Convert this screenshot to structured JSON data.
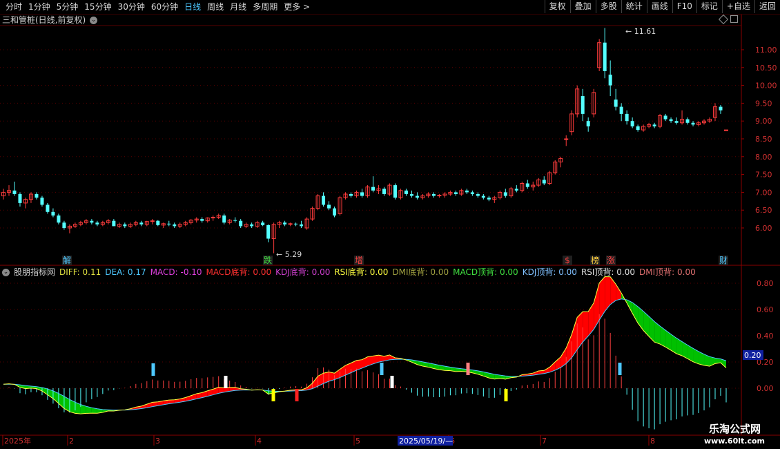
{
  "toolbar": {
    "periods": [
      "分时",
      "1分钟",
      "5分钟",
      "15分钟",
      "30分钟",
      "60分钟",
      "日线",
      "周线",
      "月线",
      "多周期",
      "更多 >"
    ],
    "active_period": "日线",
    "right_buttons": [
      "复权",
      "叠加",
      "多股",
      "统计",
      "画线",
      "F10",
      "标记",
      "+自选",
      "返回"
    ]
  },
  "chart_title": "三和管桩(日线,前复权)",
  "price_axis": [
    "11.00",
    "10.50",
    "10.00",
    "9.50",
    "9.00",
    "8.50",
    "8.00",
    "7.50",
    "7.00",
    "6.50",
    "6.00"
  ],
  "price_high_label": "11.61",
  "price_low_label": "5.29",
  "event_markers": [
    {
      "label": "解",
      "color": "#4ec8ff"
    },
    {
      "label": "跌",
      "color": "#40e040"
    },
    {
      "label": "增",
      "color": "#ff4040"
    },
    {
      "label": "$",
      "color": "#ff4040"
    },
    {
      "label": "榜",
      "color": "#ffd040"
    },
    {
      "label": "涨",
      "color": "#ff4040"
    },
    {
      "label": "财",
      "color": "#4ec8ff"
    }
  ],
  "indicator": {
    "name": "股朋指标网",
    "values": [
      {
        "label": "DIFF: 0.11",
        "color": "#e0e040"
      },
      {
        "label": "DEA: 0.17",
        "color": "#4ec8ff"
      },
      {
        "label": "MACD: -0.10",
        "color": "#e040e0"
      },
      {
        "label": "MACD底背: 0.00",
        "color": "#ff3030"
      },
      {
        "label": "KDJ底背: 0.00",
        "color": "#d040d0"
      },
      {
        "label": "RSI底背: 0.00",
        "color": "#ffff40"
      },
      {
        "label": "DMI底背: 0.00",
        "color": "#a0a040"
      },
      {
        "label": "MACD顶背: 0.00",
        "color": "#40e040"
      },
      {
        "label": "KDJ顶背: 0.00",
        "color": "#80c0ff"
      },
      {
        "label": "RSI顶背: 0.00",
        "color": "#e0e0e0"
      },
      {
        "label": "DMI顶背: 0.00",
        "color": "#e07070"
      }
    ]
  },
  "indicator_axis": [
    "0.80",
    "0.60",
    "0.40",
    "0.20",
    "0.00"
  ],
  "indicator_current": "0.20",
  "date_axis": [
    "2025年",
    "2",
    "3",
    "4",
    "5",
    "6",
    "7",
    "8"
  ],
  "crosshair_date": "2025/05/19/—",
  "watermark": {
    "line1": "乐淘公式网",
    "line2": "www.60lt.com"
  },
  "chart_data": {
    "type": "candlestick",
    "title": "三和管桩(日线,前复权)",
    "ylim": [
      5.2,
      11.8
    ],
    "candles": [
      [
        6.9,
        7.1,
        6.8,
        7.0
      ],
      [
        7.0,
        7.2,
        6.9,
        7.05
      ],
      [
        7.05,
        7.3,
        6.9,
        6.95
      ],
      [
        6.95,
        7.0,
        6.6,
        6.7
      ],
      [
        6.7,
        6.85,
        6.55,
        6.8
      ],
      [
        6.8,
        7.0,
        6.7,
        6.95
      ],
      [
        6.95,
        7.0,
        6.8,
        6.85
      ],
      [
        6.85,
        6.9,
        6.6,
        6.65
      ],
      [
        6.65,
        6.7,
        6.4,
        6.45
      ],
      [
        6.45,
        6.55,
        6.3,
        6.35
      ],
      [
        6.35,
        6.4,
        6.1,
        6.15
      ],
      [
        6.15,
        6.2,
        5.95,
        6.0
      ],
      [
        6.0,
        6.1,
        5.85,
        6.05
      ],
      [
        6.05,
        6.15,
        6.0,
        6.1
      ],
      [
        6.1,
        6.2,
        6.05,
        6.15
      ],
      [
        6.15,
        6.25,
        6.1,
        6.2
      ],
      [
        6.2,
        6.25,
        6.1,
        6.15
      ],
      [
        6.15,
        6.2,
        6.05,
        6.1
      ],
      [
        6.1,
        6.2,
        6.05,
        6.15
      ],
      [
        6.15,
        6.25,
        6.1,
        6.2
      ],
      [
        6.2,
        6.25,
        6.05,
        6.05
      ],
      [
        6.05,
        6.15,
        6.0,
        6.1
      ],
      [
        6.1,
        6.15,
        6.0,
        6.05
      ],
      [
        6.05,
        6.15,
        6.0,
        6.1
      ],
      [
        6.1,
        6.2,
        6.05,
        6.15
      ],
      [
        6.15,
        6.2,
        6.05,
        6.1
      ],
      [
        6.1,
        6.2,
        6.05,
        6.18
      ],
      [
        6.18,
        6.25,
        6.1,
        6.2
      ],
      [
        6.2,
        6.22,
        6.05,
        6.08
      ],
      [
        6.08,
        6.15,
        6.0,
        6.12
      ],
      [
        6.12,
        6.2,
        6.05,
        6.1
      ],
      [
        6.1,
        6.15,
        6.0,
        6.05
      ],
      [
        6.05,
        6.15,
        6.0,
        6.1
      ],
      [
        6.1,
        6.2,
        6.05,
        6.15
      ],
      [
        6.15,
        6.25,
        6.1,
        6.22
      ],
      [
        6.22,
        6.3,
        6.15,
        6.25
      ],
      [
        6.25,
        6.3,
        6.15,
        6.2
      ],
      [
        6.2,
        6.3,
        6.15,
        6.28
      ],
      [
        6.28,
        6.35,
        6.2,
        6.3
      ],
      [
        6.3,
        6.4,
        6.25,
        6.35
      ],
      [
        6.35,
        6.4,
        6.1,
        6.15
      ],
      [
        6.15,
        6.25,
        6.1,
        6.22
      ],
      [
        6.22,
        6.3,
        6.15,
        6.2
      ],
      [
        6.2,
        6.25,
        6.0,
        6.05
      ],
      [
        6.05,
        6.15,
        6.0,
        6.1
      ],
      [
        6.1,
        6.15,
        6.0,
        6.05
      ],
      [
        6.05,
        6.2,
        6.0,
        6.15
      ],
      [
        6.15,
        6.2,
        6.05,
        6.08
      ],
      [
        6.08,
        6.1,
        5.6,
        5.7
      ],
      [
        5.7,
        6.15,
        5.29,
        6.1
      ],
      [
        6.1,
        6.2,
        6.0,
        6.15
      ],
      [
        6.15,
        6.2,
        6.05,
        6.1
      ],
      [
        6.1,
        6.15,
        6.05,
        6.12
      ],
      [
        6.12,
        6.15,
        6.05,
        6.1
      ],
      [
        6.1,
        6.2,
        6.0,
        6.05
      ],
      [
        6.0,
        6.3,
        5.95,
        6.25
      ],
      [
        6.25,
        6.6,
        6.2,
        6.55
      ],
      [
        6.55,
        6.95,
        6.5,
        6.9
      ],
      [
        6.9,
        7.0,
        6.6,
        6.65
      ],
      [
        6.65,
        6.75,
        6.5,
        6.55
      ],
      [
        6.55,
        6.6,
        6.3,
        6.35
      ],
      [
        6.4,
        6.9,
        6.35,
        6.85
      ],
      [
        6.85,
        7.0,
        6.8,
        6.95
      ],
      [
        6.95,
        7.0,
        6.85,
        6.9
      ],
      [
        6.9,
        7.05,
        6.85,
        7.0
      ],
      [
        7.0,
        7.1,
        6.85,
        6.9
      ],
      [
        6.9,
        7.2,
        6.85,
        7.15
      ],
      [
        7.15,
        7.45,
        7.0,
        7.05
      ],
      [
        7.05,
        7.2,
        6.95,
        7.1
      ],
      [
        7.1,
        7.15,
        6.9,
        6.95
      ],
      [
        6.95,
        7.25,
        6.9,
        7.2
      ],
      [
        7.2,
        7.25,
        6.8,
        6.85
      ],
      [
        6.85,
        7.1,
        6.8,
        7.05
      ],
      [
        7.05,
        7.1,
        6.9,
        6.95
      ],
      [
        6.95,
        7.05,
        6.85,
        6.9
      ],
      [
        6.9,
        7.0,
        6.8,
        6.85
      ],
      [
        6.85,
        6.95,
        6.8,
        6.9
      ],
      [
        6.9,
        7.0,
        6.85,
        6.95
      ],
      [
        6.95,
        7.0,
        6.85,
        6.9
      ],
      [
        6.9,
        6.95,
        6.85,
        6.92
      ],
      [
        6.92,
        7.0,
        6.85,
        6.95
      ],
      [
        6.95,
        7.05,
        6.9,
        7.0
      ],
      [
        7.0,
        7.05,
        6.9,
        6.95
      ],
      [
        6.95,
        7.1,
        6.9,
        7.05
      ],
      [
        7.05,
        7.1,
        6.95,
        7.0
      ],
      [
        7.0,
        7.05,
        6.9,
        6.95
      ],
      [
        6.95,
        7.0,
        6.85,
        6.9
      ],
      [
        6.9,
        6.95,
        6.8,
        6.85
      ],
      [
        6.85,
        6.9,
        6.75,
        6.8
      ],
      [
        6.8,
        6.9,
        6.7,
        6.85
      ],
      [
        6.85,
        7.05,
        6.8,
        7.0
      ],
      [
        7.0,
        7.1,
        6.85,
        6.9
      ],
      [
        6.9,
        7.15,
        6.85,
        7.1
      ],
      [
        7.1,
        7.2,
        7.0,
        7.05
      ],
      [
        7.05,
        7.3,
        7.0,
        7.25
      ],
      [
        7.25,
        7.35,
        7.1,
        7.15
      ],
      [
        7.15,
        7.3,
        7.05,
        7.2
      ],
      [
        7.2,
        7.4,
        7.15,
        7.35
      ],
      [
        7.35,
        7.45,
        7.2,
        7.25
      ],
      [
        7.25,
        7.6,
        7.2,
        7.55
      ],
      [
        7.55,
        7.9,
        7.5,
        7.85
      ],
      [
        7.85,
        8.0,
        7.7,
        7.95
      ],
      [
        8.5,
        8.6,
        8.3,
        8.5
      ],
      [
        8.7,
        9.3,
        8.6,
        9.2
      ],
      [
        9.2,
        10.0,
        9.1,
        9.9
      ],
      [
        9.7,
        9.9,
        9.0,
        9.2
      ],
      [
        9.0,
        9.1,
        8.7,
        8.85
      ],
      [
        9.2,
        9.9,
        9.1,
        9.8
      ],
      [
        10.5,
        11.3,
        10.4,
        11.2
      ],
      [
        11.2,
        11.61,
        10.2,
        10.4
      ],
      [
        10.3,
        10.7,
        9.7,
        10.0
      ],
      [
        9.6,
        9.9,
        9.3,
        9.4
      ],
      [
        9.4,
        9.5,
        9.0,
        9.2
      ],
      [
        9.2,
        9.3,
        8.9,
        9.0
      ],
      [
        9.0,
        9.1,
        8.8,
        8.85
      ],
      [
        8.85,
        8.9,
        8.7,
        8.75
      ],
      [
        8.75,
        8.9,
        8.7,
        8.85
      ],
      [
        8.85,
        8.95,
        8.8,
        8.9
      ],
      [
        8.9,
        8.95,
        8.8,
        8.85
      ],
      [
        8.85,
        9.2,
        8.8,
        9.15
      ],
      [
        9.15,
        9.2,
        9.0,
        9.05
      ],
      [
        9.05,
        9.1,
        8.95,
        9.0
      ],
      [
        9.0,
        9.1,
        8.9,
        8.95
      ],
      [
        8.95,
        9.3,
        8.9,
        9.05
      ],
      [
        9.05,
        9.1,
        8.9,
        8.95
      ],
      [
        8.95,
        9.0,
        8.85,
        8.9
      ],
      [
        8.9,
        9.0,
        8.85,
        8.95
      ],
      [
        8.95,
        9.05,
        8.9,
        9.0
      ],
      [
        9.0,
        9.1,
        8.95,
        9.05
      ],
      [
        9.1,
        9.5,
        9.0,
        9.4
      ],
      [
        9.4,
        9.45,
        9.2,
        9.3
      ],
      [
        8.75,
        8.75,
        8.75,
        8.75
      ]
    ]
  }
}
